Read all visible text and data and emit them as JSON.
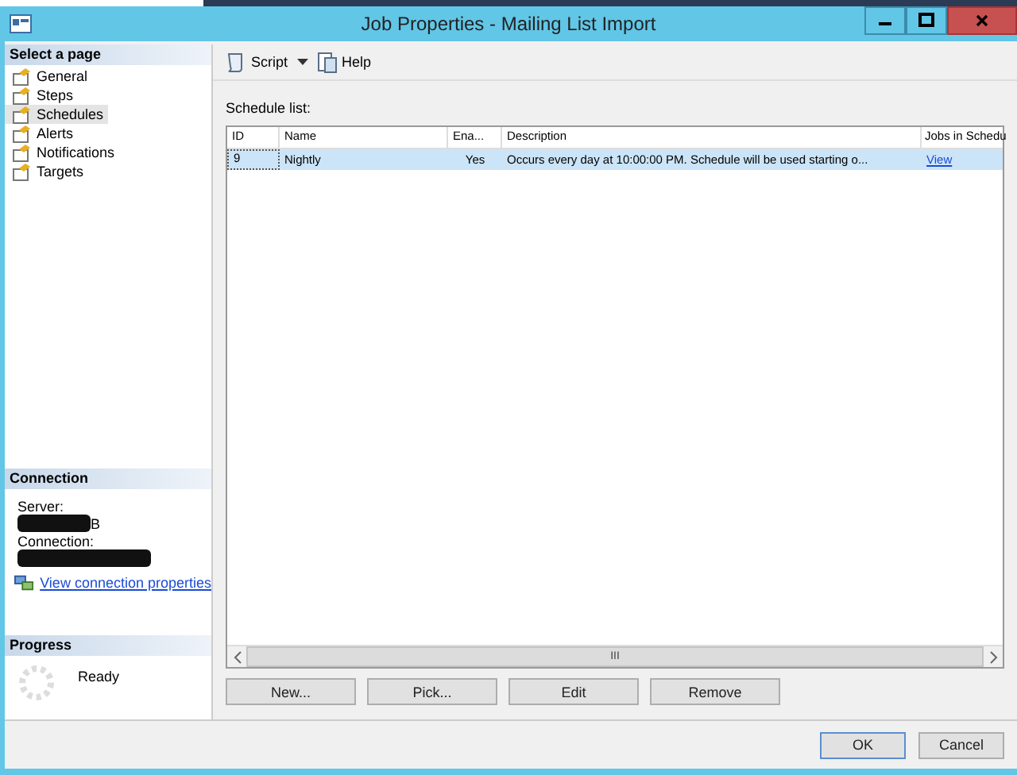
{
  "window": {
    "title": "Job Properties - Mailing List Import"
  },
  "sidebar": {
    "header": "Select a page",
    "items": [
      {
        "label": "General",
        "selected": false
      },
      {
        "label": "Steps",
        "selected": false
      },
      {
        "label": "Schedules",
        "selected": true
      },
      {
        "label": "Alerts",
        "selected": false
      },
      {
        "label": "Notifications",
        "selected": false
      },
      {
        "label": "Targets",
        "selected": false
      }
    ]
  },
  "connection": {
    "header": "Connection",
    "server_label": "Server:",
    "server_value_tail": "B",
    "connection_label": "Connection:",
    "link": "View connection properties"
  },
  "progress": {
    "header": "Progress",
    "status": "Ready"
  },
  "toolbar": {
    "script": "Script",
    "help": "Help"
  },
  "schedule_list": {
    "label": "Schedule list:",
    "columns": [
      "ID",
      "Name",
      "Ena...",
      "Description",
      "Jobs in Schedu"
    ],
    "rows": [
      {
        "selected": true,
        "cells": [
          "9",
          "Nightly",
          "Yes",
          "Occurs every day at 10:00:00 PM. Schedule will be used starting o...",
          "View"
        ]
      }
    ],
    "scroll_grip": "III"
  },
  "list_buttons": [
    "New...",
    "Pick...",
    "Edit",
    "Remove"
  ],
  "dialog_buttons": [
    "OK",
    "Cancel"
  ]
}
